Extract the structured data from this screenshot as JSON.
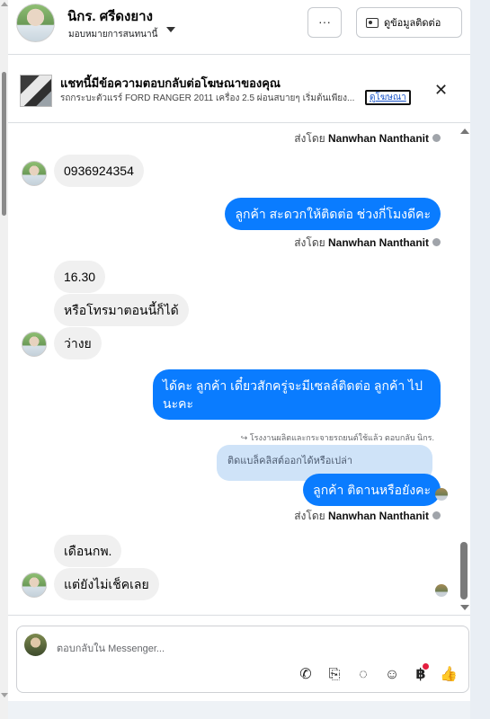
{
  "header": {
    "contact_name": "นิกร. ศรีดงยาง",
    "assign_label": "มอบหมายการสนทนานี้",
    "more_label": "···",
    "contact_info_label": "ดูข้อมูลติดต่อ"
  },
  "ad_banner": {
    "title": "แชทนี้มีข้อความตอบกลับต่อโฆษณาของคุณ",
    "description": "รถกระบะตัวแรร์ FORD RANGER 2011 เครื่อง 2.5 ผ่อนสบายๆ เริ่มต้นเพียง...",
    "link_label": "ดูโฆษณา",
    "close_label": "✕"
  },
  "messages": {
    "sent_by_prefix": "ส่งโดย",
    "sent_by_name": "Nanwhan Nanthanit",
    "m1": "0936924354",
    "m2": "ลูกค้า สะดวกให้ติดต่อ ช่วงกี่โมงดีคะ",
    "m3": "16.30",
    "m4": "หรือโทรมาตอนนี้ก็ได้",
    "m5": "ว่างย",
    "m6_line1": "ได้คะ  ลูกค้า เดี๋ยวสักครู่จะมีเซลล์ติดต่อ ลูกค้า ไป",
    "m6_line2": "นะคะ",
    "reply_note": "โรงงานผลิตและกระจายรถยนต์ใช้แล้ว ตอบกลับ นิกร.",
    "reply_quote": "ติดแบล็คลิสต์ออกได้หรือเปล่า",
    "m7": "ลูกค้า ติดานหรือยังคะ",
    "m8": "เดือนกพ.",
    "m9": "แต่ยังไม่เช็คเลย"
  },
  "composer": {
    "placeholder": "ตอบกลับใน Messenger...",
    "icons": [
      "call-add-icon",
      "paperclip-icon",
      "chat-bubble-icon",
      "smiley-icon",
      "baht-icon",
      "thumbs-up-icon"
    ]
  },
  "colors": {
    "outgoing_bubble": "#0a7cff",
    "incoming_bubble": "#f0f0f0",
    "quote_bubble": "#cfe3f8"
  }
}
